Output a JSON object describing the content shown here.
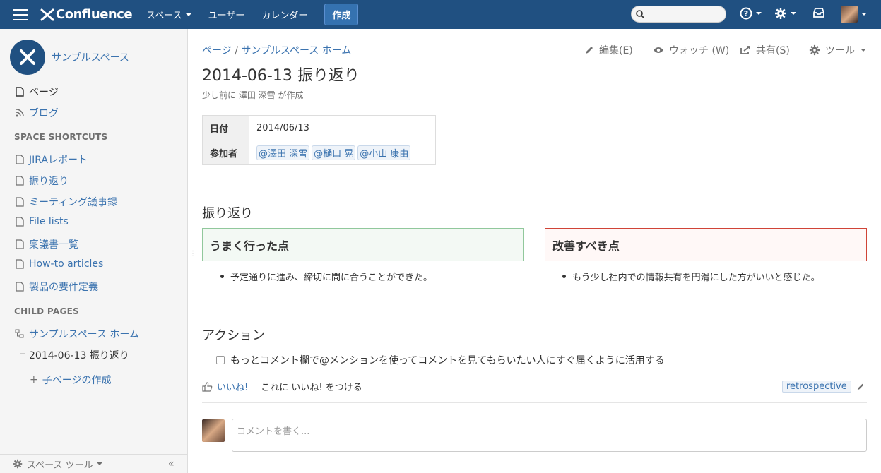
{
  "header": {
    "logo_text": "Confluence",
    "nav": [
      "スペース",
      "ユーザー",
      "カレンダー"
    ],
    "create_label": "作成",
    "search_placeholder": ""
  },
  "sidebar": {
    "space_name": "サンプルスペース",
    "main_items": [
      {
        "label": "ページ",
        "icon": "page-icon",
        "active": true
      },
      {
        "label": "ブログ",
        "icon": "rss-icon",
        "active": false
      }
    ],
    "shortcuts_heading": "SPACE SHORTCUTS",
    "shortcuts": [
      {
        "label": "JIRAレポート",
        "icon": "page-icon"
      },
      {
        "label": "振り返り",
        "icon": "page-icon"
      },
      {
        "label": "ミーティング議事録",
        "icon": "page-icon"
      },
      {
        "label": "File lists",
        "icon": "page-icon"
      },
      {
        "label": "稟議書一覧",
        "icon": "page-icon"
      },
      {
        "label": "How-to articles",
        "icon": "page-icon"
      },
      {
        "label": "製品の要件定義",
        "icon": "page-icon"
      }
    ],
    "child_heading": "CHILD PAGES",
    "child_parent": "サンプルスペース ホーム",
    "child_current": "2014-06-13 振り返り",
    "create_child": "子ページの作成",
    "footer": "スペース ツール"
  },
  "page": {
    "breadcrumb": [
      "ページ",
      "サンプルスペース ホーム"
    ],
    "actions": {
      "edit": "編集(E)",
      "watch": "ウォッチ (W)",
      "share": "共有(S)",
      "tools": "ツール"
    },
    "title": "2014-06-13 振り返り",
    "byline": "少し前に 澤田 深雪 が作成",
    "meta": {
      "date_label": "日付",
      "date_value": "2014/06/13",
      "participants_label": "参加者",
      "participants": [
        "@澤田 深雪",
        "@樋口 晃",
        "@小山 康由"
      ]
    },
    "retro_heading": "振り返り",
    "good_heading": "うまく行った点",
    "good_item": "予定通りに進み、締切に間に合うことができた。",
    "bad_heading": "改善すべき点",
    "bad_item": "もう少し社内での情報共有を円滑にした方がいいと感じた。",
    "action_heading": "アクション",
    "task": "もっとコメント欄で@メンションを使ってコメントを見てもらいたい人にすぐ届くように活用する",
    "like": "いいね!",
    "like_prompt": "これに いいね! をつける",
    "label": "retrospective",
    "comment_placeholder": "コメントを書く..."
  }
}
